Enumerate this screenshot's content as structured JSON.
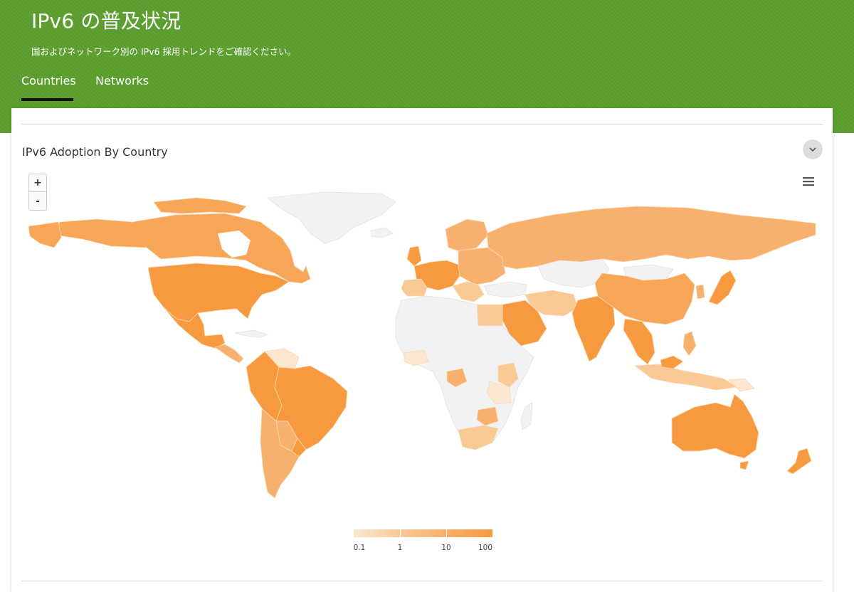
{
  "header": {
    "title": "IPv6 の普及状況",
    "subtitle": "国およびネットワーク別の IPv6 採用トレンドをご確認ください。"
  },
  "tabs": [
    {
      "label": "Countries",
      "active": true
    },
    {
      "label": "Networks",
      "active": false
    }
  ],
  "card": {
    "title": "IPv6 Adoption By Country"
  },
  "map_controls": {
    "zoom_in": "+",
    "zoom_out": "-"
  },
  "legend": {
    "ticks": [
      "0.1",
      "1",
      "10",
      "100"
    ],
    "colors": [
      "#fbe6d0",
      "#f9c996",
      "#f7b06d",
      "#f79a3f"
    ]
  },
  "colors": {
    "header_green": "#5b9f2e",
    "no_data": "#f2f2f2",
    "high": "#f79a3f",
    "mid": "#f7b06d",
    "low": "#fbe6d0"
  }
}
